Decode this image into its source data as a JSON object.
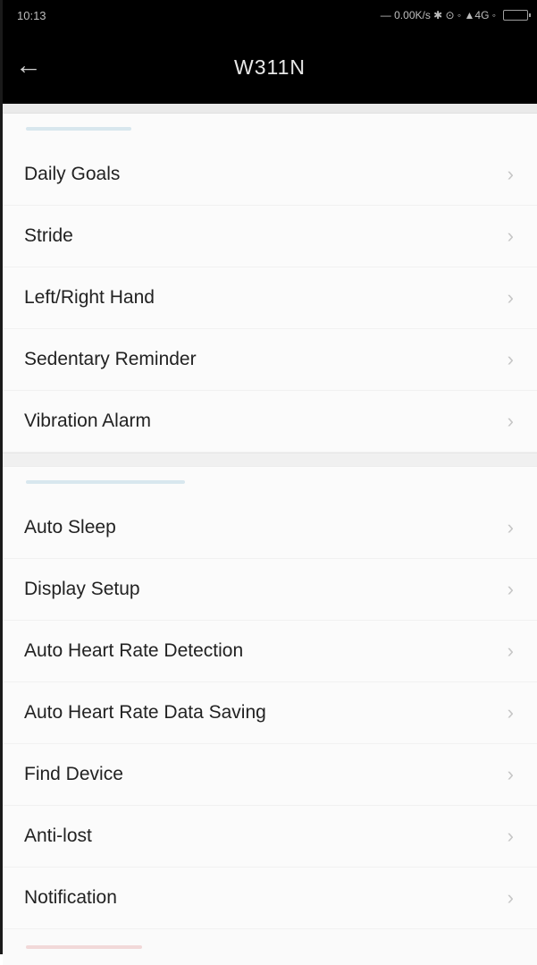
{
  "status_bar": {
    "time": "10:13",
    "indicators": "— 0.00K/s ✱ ⊙ ◦ ▲4G ◦",
    "battery_icon": "battery-icon"
  },
  "app_bar": {
    "back_icon": "back-arrow-icon",
    "back_glyph": "←",
    "title": "W311N"
  },
  "section1": {
    "items": [
      {
        "label": "Daily Goals"
      },
      {
        "label": "Stride"
      },
      {
        "label": "Left/Right Hand"
      },
      {
        "label": "Sedentary Reminder"
      },
      {
        "label": "Vibration Alarm"
      }
    ]
  },
  "section2": {
    "items": [
      {
        "label": "Auto Sleep"
      },
      {
        "label": "Display Setup"
      },
      {
        "label": "Auto Heart Rate Detection"
      },
      {
        "label": "Auto Heart Rate Data Saving"
      },
      {
        "label": "Find Device"
      },
      {
        "label": "Anti-lost"
      },
      {
        "label": "Notification"
      }
    ]
  },
  "chevron_glyph": "›",
  "colors": {
    "app_bar": "#000000",
    "background": "#fbfbfb",
    "text": "#222222",
    "chevron": "#c6c6c6"
  }
}
